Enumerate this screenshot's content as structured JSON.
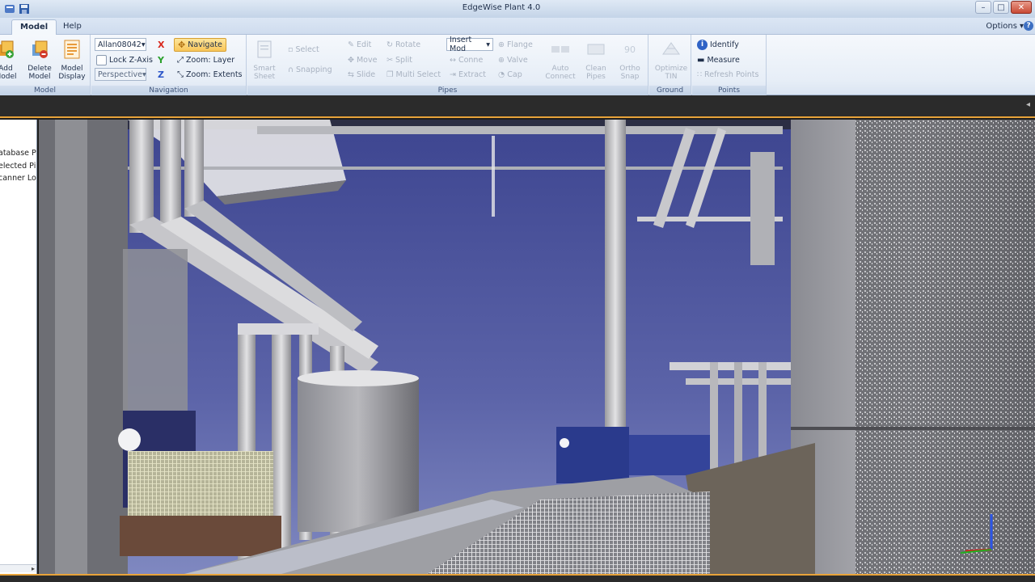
{
  "window": {
    "title": "EdgeWise Plant 4.0",
    "quick_access": [
      "app-menu-icon",
      "save-icon"
    ],
    "controls": [
      "minimize",
      "maximize",
      "close"
    ]
  },
  "tabs": {
    "model": "Model",
    "help": "Help",
    "options": "Options"
  },
  "ribbon": {
    "model_group": {
      "label": "Model",
      "add_model": [
        "Add",
        "Model"
      ],
      "delete_model": [
        "Delete",
        "Model"
      ],
      "model_display": [
        "Model",
        "Display"
      ]
    },
    "navigation_group": {
      "label": "Navigation",
      "scan_select": "Allan08042",
      "lock_z_axis": "Lock Z-Axis",
      "projection": "Perspective",
      "navigate": "Navigate",
      "zoom_layer": "Zoom: Layer",
      "zoom_extents": "Zoom: Extents",
      "axis_x": "X",
      "axis_y": "Y",
      "axis_z": "Z"
    },
    "pipes_group": {
      "label": "Pipes",
      "smart_sheet": [
        "Smart",
        "Sheet"
      ],
      "select": "Select",
      "snapping": "Snapping",
      "edit": "Edit",
      "move": "Move",
      "slide": "Slide",
      "rotate": "Rotate",
      "split": "Split",
      "multi_select": "Multi Select",
      "insert_mode": "Insert Mod",
      "connect": "Conne",
      "extract": "Extract",
      "flange": "Flange",
      "valve": "Valve",
      "cap": "Cap",
      "auto_connect": [
        "Auto",
        "Connect"
      ],
      "clean_pipes": [
        "Clean",
        "Pipes"
      ],
      "ortho_snap": [
        "Ortho",
        "Snap"
      ]
    },
    "ground_group": {
      "label": "Ground",
      "optimize_tin": [
        "Optimize",
        "TIN"
      ]
    },
    "points_group": {
      "label": "Points",
      "identify": "Identify",
      "measure": "Measure",
      "refresh_points": "Refresh Points"
    }
  },
  "left_panel": {
    "items": [
      "atabase Po",
      "elected Pip",
      "canner Loc"
    ]
  },
  "colors": {
    "accent": "#e8a33a",
    "sky": "#5b63a8",
    "ribbon_bg": "#e7eef7"
  }
}
